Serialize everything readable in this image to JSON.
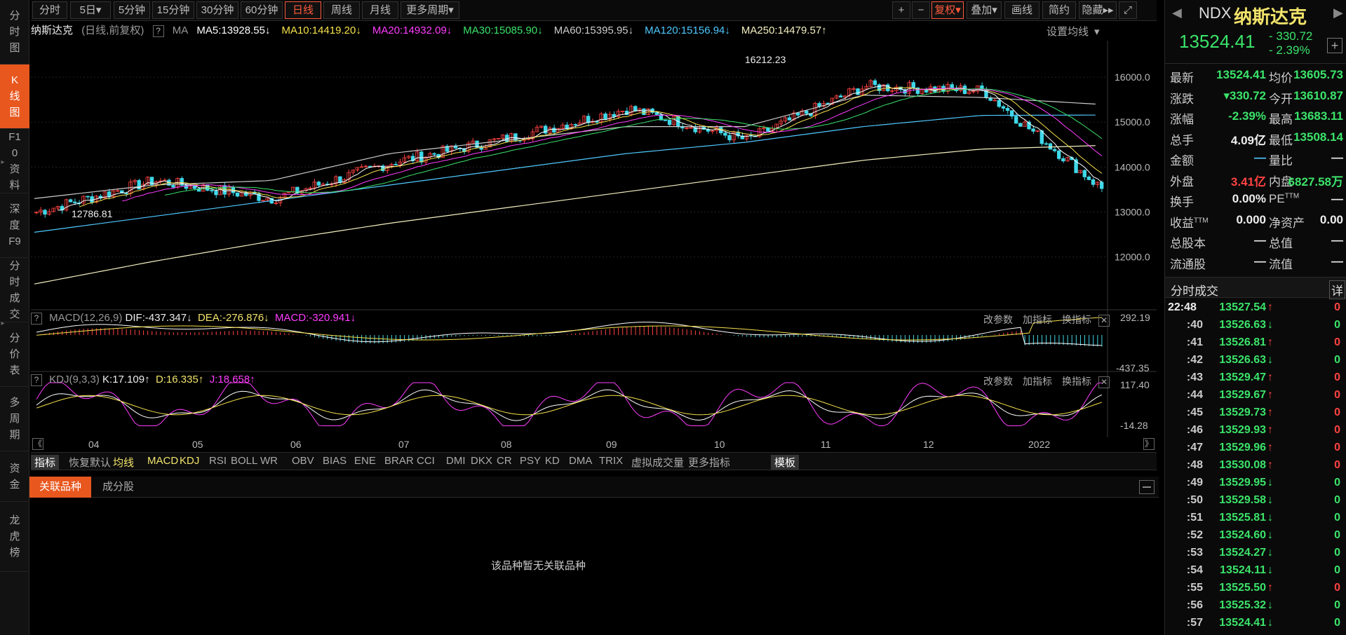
{
  "leftnav": [
    {
      "label": "分时图",
      "active": false
    },
    {
      "label": "K线图",
      "active": true
    },
    {
      "label": "F10资料",
      "active": false
    },
    {
      "label": "深度F9",
      "active": false
    },
    {
      "label": "分时成交",
      "active": false
    },
    {
      "label": "分价表",
      "active": false
    },
    {
      "label": "多周期",
      "active": false
    },
    {
      "label": "资金",
      "active": false
    },
    {
      "label": "龙虎榜",
      "active": false
    }
  ],
  "topbar": {
    "periods": [
      "分时",
      "5日",
      "5分钟",
      "15分钟",
      "30分钟",
      "60分钟",
      "日线",
      "周线",
      "月线",
      "更多周期"
    ],
    "five_day_arrow": "▾",
    "more_arrow": "▾",
    "active": "日线",
    "right": {
      "plus": "+",
      "minus": "−",
      "fuquan": "复权",
      "fuquan_arrow": "▾",
      "overlay": "叠加",
      "overlay_arrow": "▾",
      "draw": "画线",
      "simple": "简约",
      "hide": "隐藏",
      "hide_arrow": "▸▸",
      "expand": "⤢"
    }
  },
  "main_legend": {
    "name": "纳斯达克",
    "desc": "(日线,前复权)",
    "q": "?",
    "ma": "MA",
    "items": [
      {
        "text": "MA5:13928.55",
        "arrow": "↓",
        "color": "#ffffff"
      },
      {
        "text": "MA10:14419.20",
        "arrow": "↓",
        "color": "#f6e14b"
      },
      {
        "text": "MA20:14932.09",
        "arrow": "↓",
        "color": "#ff3cff"
      },
      {
        "text": "MA30:15085.90",
        "arrow": "↓",
        "color": "#3be36a"
      },
      {
        "text": "MA60:15395.95",
        "arrow": "↓",
        "color": "#cccccc"
      },
      {
        "text": "MA120:15156.94",
        "arrow": "↓",
        "color": "#4fc8ff"
      },
      {
        "text": "MA250:14479.57",
        "arrow": "↑",
        "color": "#f3f0c0"
      }
    ],
    "settings": "设置均线",
    "settings_arrow": "▾"
  },
  "macd_legend": {
    "q": "?",
    "name": "MACD(12,26,9)",
    "dif": "DIF:-437.347",
    "dif_arrow": "↓",
    "dea": "DEA:-276.876",
    "dea_arrow": "↓",
    "macd": "MACD:-320.941",
    "macd_arrow": "↓"
  },
  "kdj_legend": {
    "q": "?",
    "name": "KDJ(9,3,3)",
    "k": "K:17.109",
    "k_arrow": "↑",
    "d": "D:16.335",
    "d_arrow": "↑",
    "j": "J:18.658",
    "j_arrow": "↑"
  },
  "panel_tools": {
    "params": "改参数",
    "add": "加指标",
    "swap": "换指标",
    "close": "✕"
  },
  "price_axis": {
    "ticks": [
      "16000.0",
      "15000.0",
      "14000.0",
      "13000.0",
      "12000.0"
    ],
    "high_label": "16212.23",
    "low_label": "12786.81"
  },
  "macd_axis": {
    "top": "292.19",
    "bottom": "-437.35"
  },
  "kdj_axis": {
    "top": "117.40",
    "bottom": "-14.28"
  },
  "x_axis": {
    "labels": [
      "04",
      "05",
      "06",
      "07",
      "08",
      "09",
      "10",
      "11",
      "12",
      "2022"
    ],
    "scroll_left": "《",
    "scroll_right": "》"
  },
  "indicators": {
    "items": [
      "指标",
      "恢复默认",
      "均线",
      "MACD",
      "KDJ",
      "RSI",
      "BOLL",
      "WR",
      "OBV",
      "BIAS",
      "ENE",
      "BRAR",
      "CCI",
      "DMI",
      "DKX",
      "CR",
      "PSY",
      "KD",
      "DMA",
      "TRIX",
      "虚拟成交量",
      "更多指标",
      "模板"
    ],
    "active": "指标",
    "template": "模板"
  },
  "bottom_tabs": {
    "items": [
      "关联品种",
      "成分股"
    ],
    "active": "关联品种",
    "empty_message": "该品种暂无关联品种"
  },
  "quote": {
    "code": "NDX",
    "name": "纳斯达克",
    "price": "13524.41",
    "change": "- 330.72",
    "pct": "- 2.39%",
    "add": "+",
    "left_arrow": "◀",
    "right_arrow": "▶",
    "fields": [
      {
        "label": "最新",
        "value": "13524.41",
        "color": "green",
        "label2": "均价",
        "value2": "13605.73",
        "color2": "green"
      },
      {
        "label": "涨跌",
        "value": "▾330.72",
        "color": "green",
        "label2": "今开",
        "value2": "13610.87",
        "color2": "green"
      },
      {
        "label": "涨幅",
        "value": "-2.39%",
        "color": "green",
        "label2": "最高",
        "value2": "13683.11",
        "color2": "green"
      },
      {
        "label": "总手",
        "value": "4.09亿",
        "color": "white",
        "label2": "最低",
        "value2": "13508.14",
        "color2": "green"
      },
      {
        "label": "金额",
        "value": "—",
        "color": "cyan",
        "label2": "量比",
        "value2": "—",
        "color2": "white"
      },
      {
        "label": "外盘",
        "value": "3.41亿",
        "color": "red",
        "label2": "内盘",
        "value2": "6827.58万",
        "color2": "green"
      },
      {
        "label": "换手",
        "value": "0.00%",
        "color": "white",
        "label2": "PE",
        "sup2": "TTM",
        "value2": "—",
        "color2": "white"
      },
      {
        "label": "收益",
        "sup": "TTM",
        "value": "0.000",
        "color": "white",
        "label2": "净资产",
        "value2": "0.00",
        "color2": "white"
      },
      {
        "label": "总股本",
        "value": "—",
        "color": "white",
        "label2": "总值",
        "value2": "—",
        "color2": "white"
      },
      {
        "label": "流通股",
        "value": "—",
        "color": "white",
        "label2": "流值",
        "value2": "—",
        "color2": "white"
      }
    ]
  },
  "ticks_title": "分时成交",
  "ticks_detail": "详",
  "ticks": [
    {
      "time": "22:48",
      "price": "13527.54",
      "dir": "↑",
      "vol": "0"
    },
    {
      "time": ":40",
      "price": "13526.63",
      "dir": "↓",
      "vol": "0"
    },
    {
      "time": ":41",
      "price": "13526.81",
      "dir": "↑",
      "vol": "0"
    },
    {
      "time": ":42",
      "price": "13526.63",
      "dir": "↓",
      "vol": "0"
    },
    {
      "time": ":43",
      "price": "13529.47",
      "dir": "↑",
      "vol": "0"
    },
    {
      "time": ":44",
      "price": "13529.67",
      "dir": "↑",
      "vol": "0"
    },
    {
      "time": ":45",
      "price": "13529.73",
      "dir": "↑",
      "vol": "0"
    },
    {
      "time": ":46",
      "price": "13529.93",
      "dir": "↑",
      "vol": "0"
    },
    {
      "time": ":47",
      "price": "13529.96",
      "dir": "↑",
      "vol": "0"
    },
    {
      "time": ":48",
      "price": "13530.08",
      "dir": "↑",
      "vol": "0"
    },
    {
      "time": ":49",
      "price": "13529.95",
      "dir": "↓",
      "vol": "0"
    },
    {
      "time": ":50",
      "price": "13529.58",
      "dir": "↓",
      "vol": "0"
    },
    {
      "time": ":51",
      "price": "13525.81",
      "dir": "↓",
      "vol": "0"
    },
    {
      "time": ":52",
      "price": "13524.60",
      "dir": "↓",
      "vol": "0"
    },
    {
      "time": ":53",
      "price": "13524.27",
      "dir": "↓",
      "vol": "0"
    },
    {
      "time": ":54",
      "price": "13524.11",
      "dir": "↓",
      "vol": "0"
    },
    {
      "time": ":55",
      "price": "13525.50",
      "dir": "↑",
      "vol": "0"
    },
    {
      "time": ":56",
      "price": "13525.32",
      "dir": "↓",
      "vol": "0"
    },
    {
      "time": ":57",
      "price": "13524.41",
      "dir": "↓",
      "vol": "0"
    }
  ],
  "chart_data": {
    "type": "line",
    "title": "纳斯达克",
    "ylim": [
      11200,
      16500
    ],
    "x": [
      "04",
      "05",
      "06",
      "07",
      "08",
      "09",
      "10",
      "11",
      "12",
      "2022"
    ],
    "series": [
      {
        "name": "MA250",
        "values": [
          11400,
          11900,
          12350,
          12750,
          13100,
          13450,
          13800,
          14150,
          14400,
          14480
        ]
      },
      {
        "name": "MA120",
        "values": [
          12550,
          12900,
          13250,
          13600,
          13950,
          14300,
          14550,
          14900,
          15150,
          15157
        ]
      },
      {
        "name": "MA60",
        "values": [
          13300,
          13600,
          13700,
          14300,
          14600,
          14900,
          14900,
          15600,
          15550,
          15396
        ]
      },
      {
        "name": "close",
        "values": [
          13000,
          13700,
          13300,
          14100,
          14650,
          15300,
          14600,
          15800,
          15700,
          13524
        ]
      }
    ],
    "annotations": [
      {
        "text": "16212.23"
      },
      {
        "text": "12786.81"
      }
    ]
  }
}
